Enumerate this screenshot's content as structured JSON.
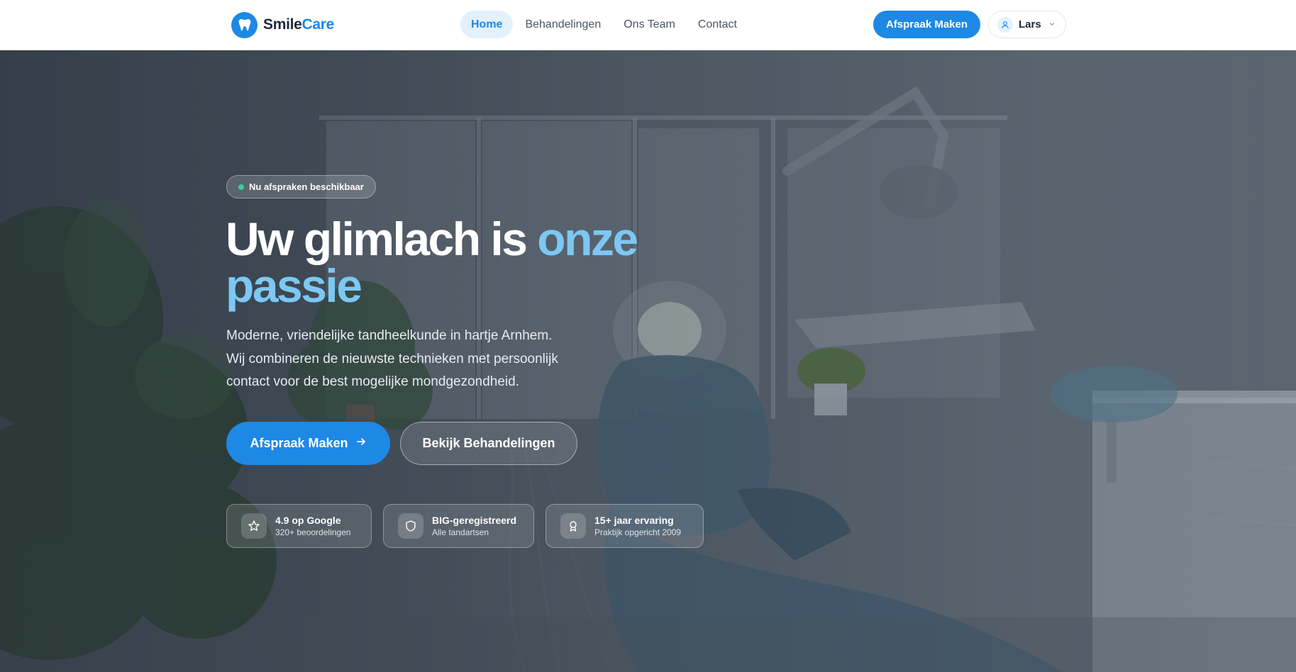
{
  "brand": {
    "name_part1": "Smile",
    "name_part2": "Care",
    "icon": "tooth-icon"
  },
  "nav": {
    "links": [
      {
        "label": "Home",
        "active": true
      },
      {
        "label": "Behandelingen",
        "active": false
      },
      {
        "label": "Ons Team",
        "active": false
      },
      {
        "label": "Contact",
        "active": false
      }
    ],
    "cta_label": "Afspraak Maken",
    "user": {
      "name": "Lars",
      "icon": "user-icon"
    }
  },
  "hero": {
    "badge": "Nu afspraken beschikbaar",
    "headline_part1": "Uw glimlach is ",
    "headline_accent": "onze passie",
    "lead_lines": [
      "Moderne, vriendelijke tandheelkunde in hartje Arnhem.",
      "Wij combineren de nieuwste technieken met persoonlijk",
      "contact voor de best mogelijke mondgezondheid."
    ],
    "primary_button": "Afspraak Maken",
    "secondary_button": "Bekijk Behandelingen",
    "stats": [
      {
        "title": "4.9 op Google",
        "subtitle": "320+ beoordelingen",
        "icon": "star-icon"
      },
      {
        "title": "BIG-geregistreerd",
        "subtitle": "Alle tandartsen",
        "icon": "shield-icon"
      },
      {
        "title": "15+ jaar ervaring",
        "subtitle": "Praktijk opgericht 2009",
        "icon": "award-icon"
      }
    ]
  },
  "colors": {
    "primary": "#1e88e5",
    "accent_light": "#7cc8f2",
    "badge_dot": "#34d399",
    "nav_active_bg": "#e3f1fd"
  }
}
